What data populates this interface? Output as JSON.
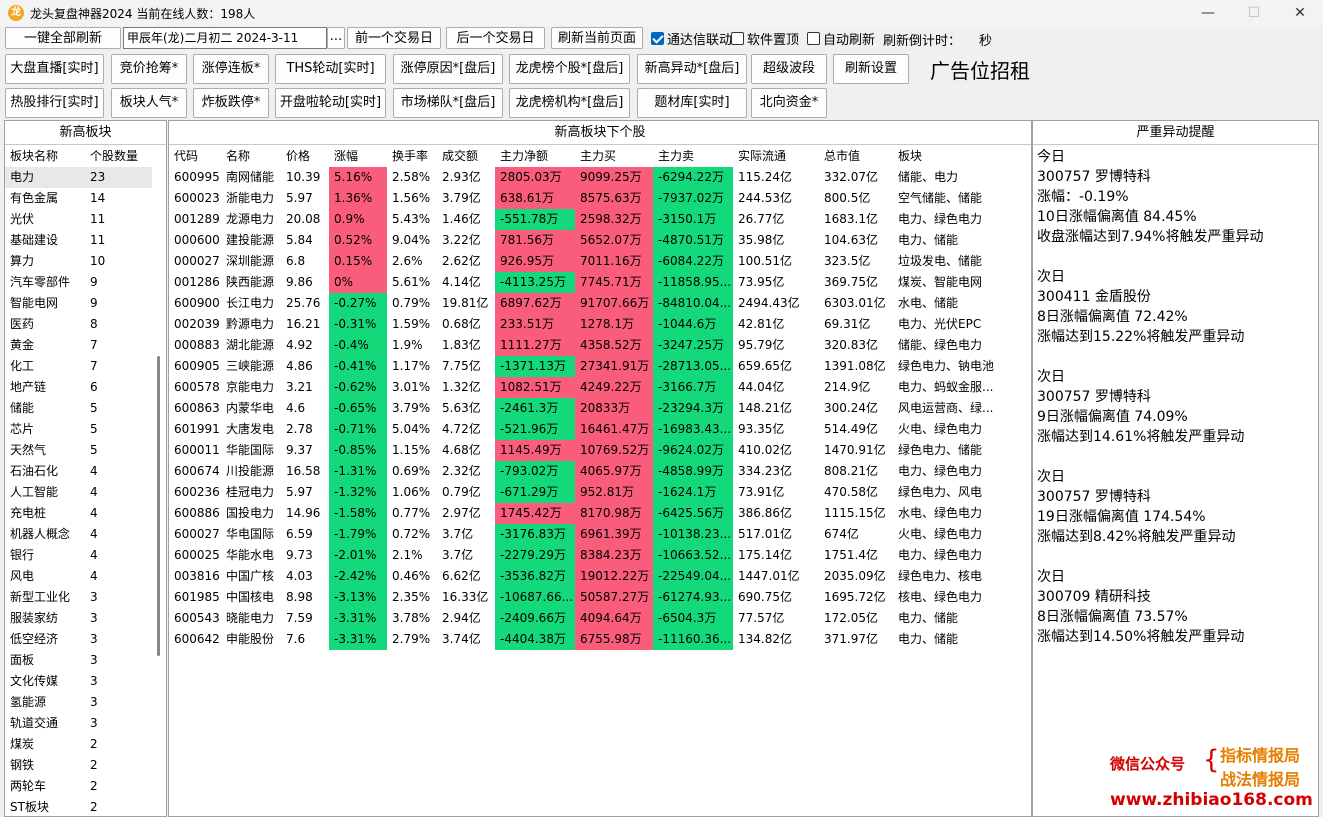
{
  "window": {
    "title": "龙头复盘神器2024 当前在线人数：198人",
    "icon": "dragon-app-icon"
  },
  "toolbar1": {
    "refresh_all": "一键全部刷新",
    "date_value": "甲辰年(龙)二月初二  2024-3-11",
    "date_picker": "...",
    "prev_day": "前一个交易日",
    "next_day": "后一个交易日",
    "refresh_page": "刷新当前页面",
    "tdx_link": "通达信联动",
    "topmost": "软件置顶",
    "auto_refresh": "自动刷新",
    "countdown_label": "刷新倒计时：",
    "countdown_unit": "秒"
  },
  "toolbar2": [
    "大盘直播[实时]",
    "竞价抢筹*",
    "涨停连板*",
    "THS轮动[实时]",
    "涨停原因*[盘后]",
    "龙虎榜个股*[盘后]",
    "新高异动*[盘后]",
    "超级波段",
    "刷新设置"
  ],
  "toolbar3": [
    "热股排行[实时]",
    "板块人气*",
    "炸板跌停*",
    "开盘啦轮动[实时]",
    "市场梯队*[盘后]",
    "龙虎榜机构*[盘后]",
    "题材库[实时]",
    "北向资金*"
  ],
  "ad_text": "广告位招租",
  "left_panel": {
    "title": "新高板块",
    "headers": [
      "板块名称",
      "个股数量"
    ],
    "rows": [
      [
        "电力",
        "23"
      ],
      [
        "有色金属",
        "14"
      ],
      [
        "光伏",
        "11"
      ],
      [
        "基础建设",
        "11"
      ],
      [
        "算力",
        "10"
      ],
      [
        "汽车零部件",
        "9"
      ],
      [
        "智能电网",
        "9"
      ],
      [
        "医药",
        "8"
      ],
      [
        "黄金",
        "7"
      ],
      [
        "化工",
        "7"
      ],
      [
        "地产链",
        "6"
      ],
      [
        "储能",
        "5"
      ],
      [
        "芯片",
        "5"
      ],
      [
        "天然气",
        "5"
      ],
      [
        "石油石化",
        "4"
      ],
      [
        "人工智能",
        "4"
      ],
      [
        "充电桩",
        "4"
      ],
      [
        "机器人概念",
        "4"
      ],
      [
        "银行",
        "4"
      ],
      [
        "风电",
        "4"
      ],
      [
        "新型工业化",
        "3"
      ],
      [
        "服装家纺",
        "3"
      ],
      [
        "低空经济",
        "3"
      ],
      [
        "面板",
        "3"
      ],
      [
        "文化传媒",
        "3"
      ],
      [
        "氢能源",
        "3"
      ],
      [
        "轨道交通",
        "3"
      ],
      [
        "煤炭",
        "2"
      ],
      [
        "钢铁",
        "2"
      ],
      [
        "两轮车",
        "2"
      ],
      [
        "ST板块",
        "2"
      ]
    ]
  },
  "main_panel": {
    "title": "新高板块下个股",
    "headers": [
      "代码",
      "名称",
      "价格",
      "涨幅",
      "换手率",
      "成交额",
      "主力净额",
      "主力买",
      "主力卖",
      "实际流通",
      "总市值",
      "板块"
    ],
    "rows": [
      [
        "600995",
        "南网储能",
        "10.39",
        "5.16%",
        "2.58%",
        "2.93亿",
        "2805.03万",
        "9099.25万",
        "-6294.22万",
        "115.24亿",
        "332.07亿",
        "储能、电力"
      ],
      [
        "600023",
        "浙能电力",
        "5.97",
        "1.36%",
        "1.56%",
        "3.79亿",
        "638.61万",
        "8575.63万",
        "-7937.02万",
        "244.53亿",
        "800.5亿",
        "空气储能、储能"
      ],
      [
        "001289",
        "龙源电力",
        "20.08",
        "0.9%",
        "5.43%",
        "1.46亿",
        "-551.78万",
        "2598.32万",
        "-3150.1万",
        "26.77亿",
        "1683.1亿",
        "电力、绿色电力"
      ],
      [
        "000600",
        "建投能源",
        "5.84",
        "0.52%",
        "9.04%",
        "3.22亿",
        "781.56万",
        "5652.07万",
        "-4870.51万",
        "35.98亿",
        "104.63亿",
        "电力、储能"
      ],
      [
        "000027",
        "深圳能源",
        "6.8",
        "0.15%",
        "2.6%",
        "2.62亿",
        "926.95万",
        "7011.16万",
        "-6084.22万",
        "100.51亿",
        "323.5亿",
        "垃圾发电、储能"
      ],
      [
        "001286",
        "陕西能源",
        "9.86",
        "0%",
        "5.61%",
        "4.14亿",
        "-4113.25万",
        "7745.71万",
        "-11858.95...",
        "73.95亿",
        "369.75亿",
        "煤炭、智能电网"
      ],
      [
        "600900",
        "长江电力",
        "25.76",
        "-0.27%",
        "0.79%",
        "19.81亿",
        "6897.62万",
        "91707.66万",
        "-84810.04...",
        "2494.43亿",
        "6303.01亿",
        "水电、储能"
      ],
      [
        "002039",
        "黔源电力",
        "16.21",
        "-0.31%",
        "1.59%",
        "0.68亿",
        "233.51万",
        "1278.1万",
        "-1044.6万",
        "42.81亿",
        "69.31亿",
        "电力、光伏EPC"
      ],
      [
        "000883",
        "湖北能源",
        "4.92",
        "-0.4%",
        "1.9%",
        "1.83亿",
        "1111.27万",
        "4358.52万",
        "-3247.25万",
        "95.79亿",
        "320.83亿",
        "储能、绿色电力"
      ],
      [
        "600905",
        "三峡能源",
        "4.86",
        "-0.41%",
        "1.17%",
        "7.75亿",
        "-1371.13万",
        "27341.91万",
        "-28713.05...",
        "659.65亿",
        "1391.08亿",
        "绿色电力、钠电池"
      ],
      [
        "600578",
        "京能电力",
        "3.21",
        "-0.62%",
        "3.01%",
        "1.32亿",
        "1082.51万",
        "4249.22万",
        "-3166.7万",
        "44.04亿",
        "214.9亿",
        "电力、蚂蚁金服..."
      ],
      [
        "600863",
        "内蒙华电",
        "4.6",
        "-0.65%",
        "3.79%",
        "5.63亿",
        "-2461.3万",
        "20833万",
        "-23294.3万",
        "148.21亿",
        "300.24亿",
        "风电运营商、绿..."
      ],
      [
        "601991",
        "大唐发电",
        "2.78",
        "-0.71%",
        "5.04%",
        "4.72亿",
        "-521.96万",
        "16461.47万",
        "-16983.43...",
        "93.35亿",
        "514.49亿",
        "火电、绿色电力"
      ],
      [
        "600011",
        "华能国际",
        "9.37",
        "-0.85%",
        "1.15%",
        "4.68亿",
        "1145.49万",
        "10769.52万",
        "-9624.02万",
        "410.02亿",
        "1470.91亿",
        "绿色电力、储能"
      ],
      [
        "600674",
        "川投能源",
        "16.58",
        "-1.31%",
        "0.69%",
        "2.32亿",
        "-793.02万",
        "4065.97万",
        "-4858.99万",
        "334.23亿",
        "808.21亿",
        "电力、绿色电力"
      ],
      [
        "600236",
        "桂冠电力",
        "5.97",
        "-1.32%",
        "1.06%",
        "0.79亿",
        "-671.29万",
        "952.81万",
        "-1624.1万",
        "73.91亿",
        "470.58亿",
        "绿色电力、风电"
      ],
      [
        "600886",
        "国投电力",
        "14.96",
        "-1.58%",
        "0.77%",
        "2.97亿",
        "1745.42万",
        "8170.98万",
        "-6425.56万",
        "386.86亿",
        "1115.15亿",
        "水电、绿色电力"
      ],
      [
        "600027",
        "华电国际",
        "6.59",
        "-1.79%",
        "0.72%",
        "3.7亿",
        "-3176.83万",
        "6961.39万",
        "-10138.23...",
        "517.01亿",
        "674亿",
        "火电、绿色电力"
      ],
      [
        "600025",
        "华能水电",
        "9.73",
        "-2.01%",
        "2.1%",
        "3.7亿",
        "-2279.29万",
        "8384.23万",
        "-10663.52...",
        "175.14亿",
        "1751.4亿",
        "电力、绿色电力"
      ],
      [
        "003816",
        "中国广核",
        "4.03",
        "-2.42%",
        "0.46%",
        "6.62亿",
        "-3536.82万",
        "19012.22万",
        "-22549.04...",
        "1447.01亿",
        "2035.09亿",
        "绿色电力、核电"
      ],
      [
        "601985",
        "中国核电",
        "8.98",
        "-3.13%",
        "2.35%",
        "16.33亿",
        "-10687.66...",
        "50587.27万",
        "-61274.93...",
        "690.75亿",
        "1695.72亿",
        "核电、绿色电力"
      ],
      [
        "600543",
        "晓能电力",
        "7.59",
        "-3.31%",
        "3.78%",
        "2.94亿",
        "-2409.66万",
        "4094.64万",
        "-6504.3万",
        "77.57亿",
        "172.05亿",
        "电力、储能"
      ],
      [
        "600642",
        "申能股份",
        "7.6",
        "-3.31%",
        "2.79%",
        "3.74亿",
        "-4404.38万",
        "6755.98万",
        "-11160.36...",
        "134.82亿",
        "371.97亿",
        "电力、储能"
      ]
    ]
  },
  "right_panel": {
    "title": "严重异动提醒",
    "items": [
      [
        "今日",
        "300757 罗博特科",
        "涨幅：-0.19%",
        "10日涨幅偏离值 84.45%",
        "收盘涨幅达到7.94%将触发严重异动"
      ],
      [
        "次日",
        "300411 金盾股份",
        "8日涨幅偏离值 72.42%",
        "涨幅达到15.22%将触发严重异动"
      ],
      [
        "次日",
        "300757 罗博特科",
        "9日涨幅偏离值 74.09%",
        "涨幅达到14.61%将触发严重异动"
      ],
      [
        "次日",
        "300757 罗博特科",
        "19日涨幅偏离值 174.54%",
        "涨幅达到8.42%将触发严重异动"
      ],
      [
        "次日",
        "300709 精研科技",
        "8日涨幅偏离值 73.57%",
        "涨幅达到14.50%将触发严重异动"
      ]
    ]
  },
  "watermark": {
    "wechat": "微信公众号",
    "line1": "指标情报局",
    "line2": "战法情报局",
    "url": "www.zhibiao168.com"
  },
  "colors": {
    "up": "#fa5c7c",
    "down": "#14d97b",
    "accent": "#0067c0",
    "brand_red": "#d40000"
  }
}
